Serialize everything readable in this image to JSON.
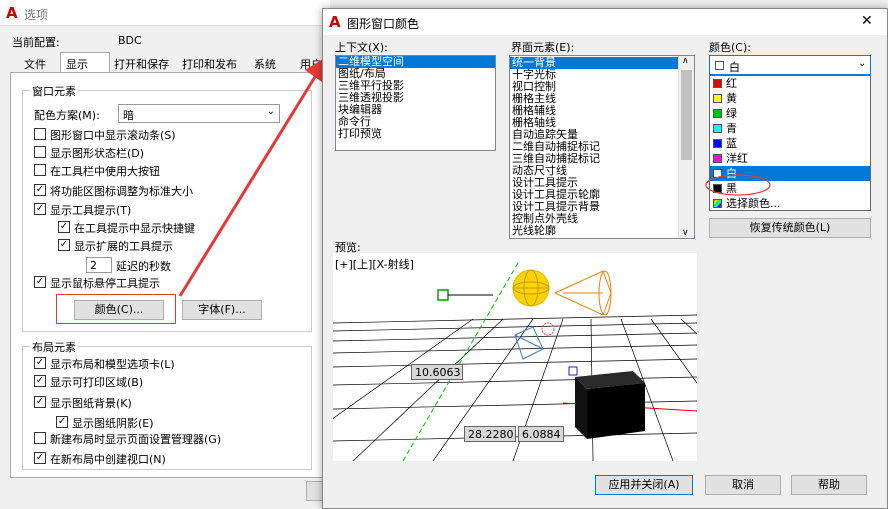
{
  "options": {
    "title": "选项",
    "profile_label": "当前配置:",
    "profile_value": "BDC",
    "tabs": [
      "文件",
      "显示",
      "打开和保存",
      "打印和发布",
      "系统",
      "用户"
    ],
    "window_group": "窗口元素",
    "scheme_label": "配色方案(M):",
    "scheme_value": "暗",
    "checks": [
      {
        "label": "图形窗口中显示滚动条(S)",
        "checked": false
      },
      {
        "label": "显示图形状态栏(D)",
        "checked": false
      },
      {
        "label": "在工具栏中使用大按钮",
        "checked": false
      },
      {
        "label": "将功能区图标调整为标准大小",
        "checked": true
      },
      {
        "label": "显示工具提示(T)",
        "checked": true
      },
      {
        "label": "在工具提示中显示快捷键",
        "checked": true
      },
      {
        "label": "显示扩展的工具提示",
        "checked": true
      },
      {
        "label": "显示鼠标悬停工具提示",
        "checked": true
      }
    ],
    "delay_value": "2",
    "delay_label": "延迟的秒数",
    "color_button": "颜色(C)...",
    "font_button": "字体(F)...",
    "layout_group": "布局元素",
    "layout_checks": [
      {
        "label": "显示布局和模型选项卡(L)",
        "checked": true
      },
      {
        "label": "显示可打印区域(B)",
        "checked": true
      },
      {
        "label": "显示图纸背景(K)",
        "checked": true
      },
      {
        "label": "显示图纸阴影(E)",
        "checked": true
      },
      {
        "label": "新建布局时显示页面设置管理器(G)",
        "checked": false
      },
      {
        "label": "在新布局中创建视口(N)",
        "checked": true
      }
    ]
  },
  "dialog": {
    "title": "图形窗口颜色",
    "close_glyph": "✕",
    "context_label": "上下文(X):",
    "context_items": [
      "二维模型空间",
      "图纸/布局",
      "三维平行投影",
      "三维透视投影",
      "块编辑器",
      "命令行",
      "打印预览"
    ],
    "element_label": "界面元素(E):",
    "element_items": [
      "统一背景",
      "十字光标",
      "视口控制",
      "栅格主线",
      "栅格辅线",
      "栅格轴线",
      "自动追踪矢量",
      "二维自动捕捉标记",
      "三维自动捕捉标记",
      "动态尺寸线",
      "设计工具提示",
      "设计工具提示轮廓",
      "设计工具提示背景",
      "控制点外壳线",
      "光线轮廓"
    ],
    "color_label": "颜色(C):",
    "color_value": "白",
    "color_options": [
      {
        "name": "红",
        "color": "#e60000"
      },
      {
        "name": "黄",
        "color": "#ffff00"
      },
      {
        "name": "绿",
        "color": "#00c000"
      },
      {
        "name": "青",
        "color": "#00ffff"
      },
      {
        "name": "蓝",
        "color": "#0000ff"
      },
      {
        "name": "洋红",
        "color": "#ff00ff"
      },
      {
        "name": "白",
        "color": "#ffffff"
      },
      {
        "name": "黑",
        "color": "#000000"
      },
      {
        "name": "选择颜色...",
        "color": "multi"
      }
    ],
    "restore_button": "恢复传统颜色(L)",
    "preview_label": "预览:",
    "viewport_label": "[+][上][X-射线]",
    "dim1": "10.6063",
    "dim2": "28.2280",
    "dim3": "6.0884",
    "apply_button": "应用并关闭(A)",
    "cancel_button": "取消",
    "help_button": "帮助"
  }
}
